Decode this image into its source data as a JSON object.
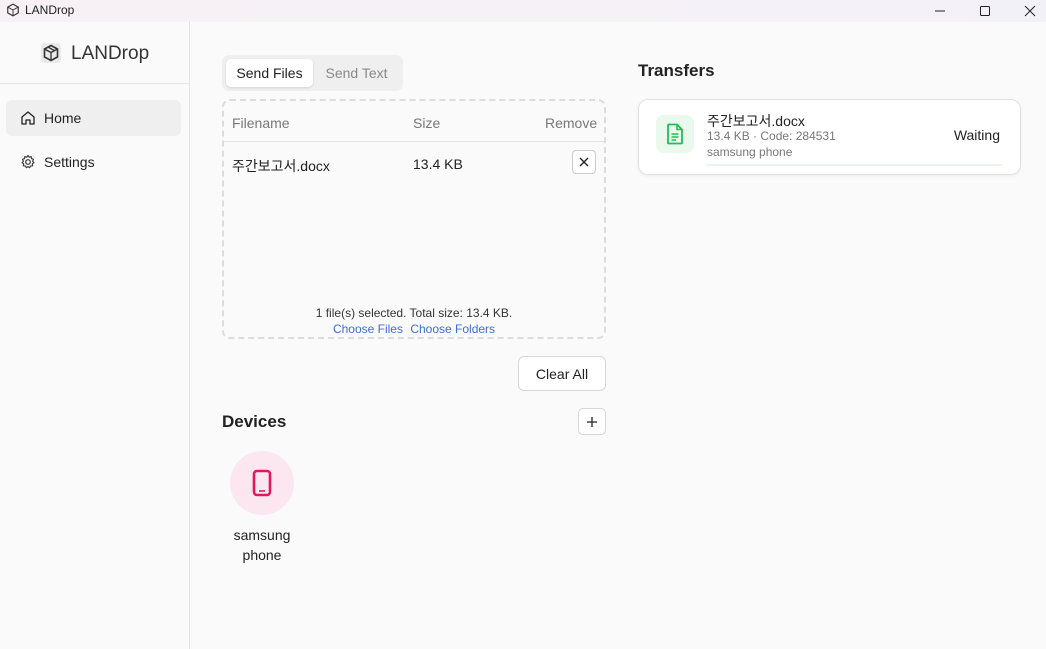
{
  "window": {
    "title": "LANDrop"
  },
  "sidebar": {
    "brand": "LANDrop",
    "items": [
      {
        "label": "Home",
        "icon": "home-icon",
        "active": true
      },
      {
        "label": "Settings",
        "icon": "gear-icon",
        "active": false
      }
    ]
  },
  "send": {
    "tabs": [
      {
        "label": "Send Files",
        "active": true
      },
      {
        "label": "Send Text",
        "active": false
      }
    ],
    "columns": [
      "Filename",
      "Size",
      "Remove"
    ],
    "files": [
      {
        "name": "주간보고서.docx",
        "size": "13.4 KB"
      }
    ],
    "summary": "1 file(s) selected. Total size: 13.4 KB.",
    "choose_files": "Choose Files",
    "choose_folders": "Choose Folders",
    "clear_all": "Clear All"
  },
  "devices": {
    "title": "Devices",
    "add_icon": "plus-icon",
    "items": [
      {
        "name": "samsung phone",
        "icon": "phone-icon",
        "color": "#e0185c"
      }
    ]
  },
  "transfers": {
    "title": "Transfers",
    "items": [
      {
        "name": "주간보고서.docx",
        "meta": "13.4 KB · Code: 284531",
        "device": "samsung phone",
        "status": "Waiting",
        "icon": "document-icon",
        "icon_color": "#1fbf55"
      }
    ]
  },
  "colors": {
    "accent_link": "#3b6fd4",
    "device_bg": "#fce7f1",
    "file_icon_bg": "#e9f9ee"
  }
}
